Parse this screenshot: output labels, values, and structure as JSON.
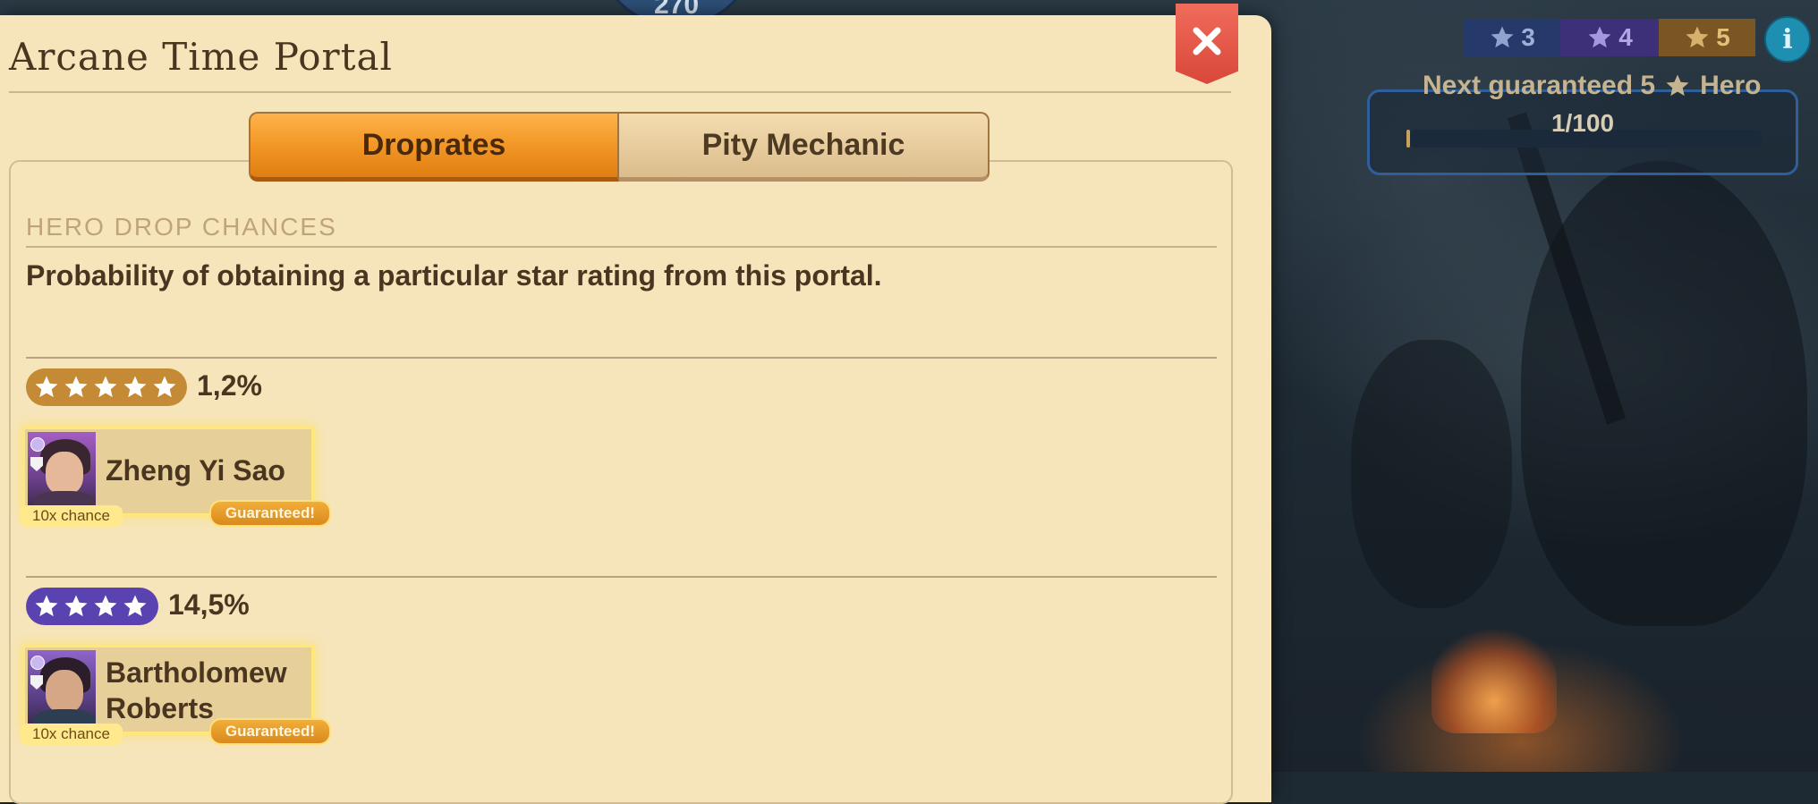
{
  "background_gem_value": "270",
  "dialog": {
    "title": "Arcane Time Portal",
    "tabs": [
      {
        "label": "Droprates",
        "active": true
      },
      {
        "label": "Pity Mechanic",
        "active": false
      }
    ],
    "section_heading": "HERO DROP CHANCES",
    "description": "Probability of obtaining a particular star rating from this portal.",
    "tiers": [
      {
        "stars": 5,
        "pill_color": "#c48a35",
        "percentage": "1,2%",
        "hero": {
          "name_line1": "Zheng Yi Sao",
          "name_line2": "",
          "chance_tag": "10x chance",
          "guaranteed_tag": "Guaranteed!"
        }
      },
      {
        "stars": 4,
        "pill_color": "#5a43b0",
        "percentage": "14,5%",
        "hero": {
          "name_line1": "Bartholomew",
          "name_line2": "Roberts",
          "chance_tag": "10x chance",
          "guaranteed_tag": "Guaranteed!"
        }
      }
    ]
  },
  "hud": {
    "star_filters": [
      {
        "label": "3",
        "color": "#253a6a"
      },
      {
        "label": "4",
        "color": "#3d2f78"
      },
      {
        "label": "5",
        "color": "#7a5625"
      }
    ],
    "info_label": "i",
    "guarantee": {
      "label_prefix": "Next guaranteed 5",
      "label_suffix": "Hero",
      "progress_text": "1/100",
      "progress_fraction": 0.01
    }
  },
  "icons": {
    "close": "close-icon",
    "star": "star-icon",
    "info": "info-icon"
  }
}
